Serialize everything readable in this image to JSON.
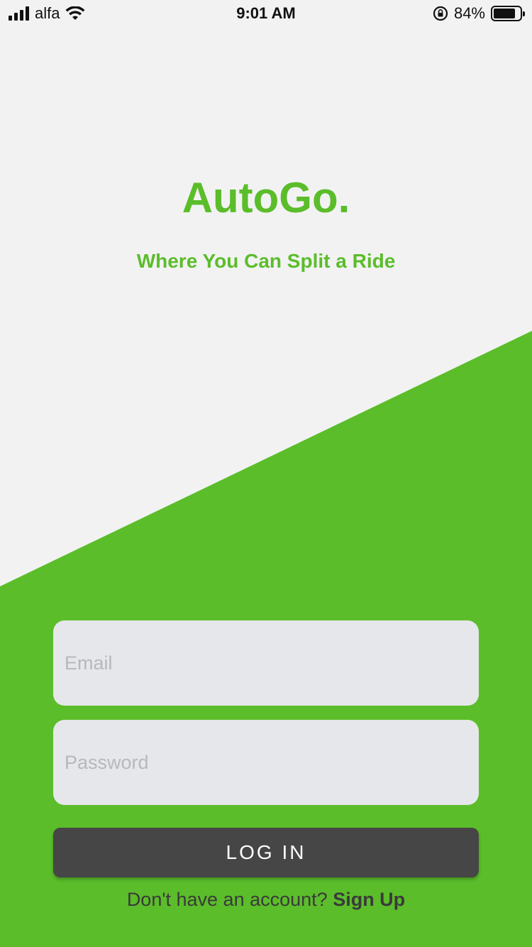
{
  "status_bar": {
    "carrier": "alfa",
    "time": "9:01 AM",
    "battery": "84%",
    "battery_level": 0.84,
    "icons": [
      "signal-icon",
      "wifi-icon",
      "rotation-lock-icon",
      "battery-icon"
    ]
  },
  "brand": {
    "title": "AutoGo.",
    "tagline": "Where You Can Split a Ride"
  },
  "form": {
    "email_placeholder": "Email",
    "password_placeholder": "Password",
    "login_label": "LOG IN",
    "signup_prompt": "Don't have an account?",
    "signup_link": "Sign Up"
  },
  "colors": {
    "brand_green": "#5bbd2a",
    "background": "#f2f2f3",
    "field_bg": "#e6e7ea",
    "button_bg": "#464646"
  }
}
